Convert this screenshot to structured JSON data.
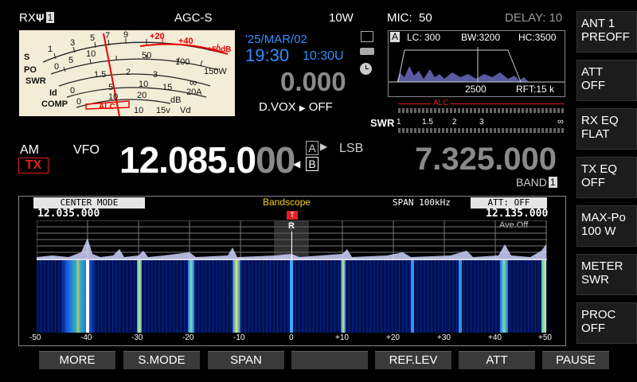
{
  "top": {
    "rx_label": "RX",
    "rx_num": "1",
    "agc": "AGC-S",
    "power": "10W",
    "mic_label": "MIC:",
    "mic_value": "50",
    "delay": "DELAY: 10"
  },
  "meter": {
    "scales": [
      "S",
      "PO",
      "SWR",
      "Id",
      "COMP"
    ],
    "s_ticks": [
      "1",
      "3",
      "5",
      "7",
      "9"
    ],
    "s_plus": [
      "+20",
      "+40",
      "+60dB"
    ],
    "po_ticks": [
      "0",
      "5",
      "10",
      "25",
      "50",
      "100",
      "150W"
    ],
    "swr_ticks": [
      "1",
      "1.5",
      "2",
      "3",
      "∞"
    ],
    "id_ticks": [
      "0",
      "5",
      "10",
      "15",
      "20A"
    ],
    "comp_ticks": [
      "0",
      "10",
      "20",
      "dB"
    ],
    "vd_ticks": [
      "10",
      "15v",
      "Vd"
    ],
    "alc": "ALC"
  },
  "clock": {
    "date": "'25/MAR/02",
    "time": "19:30",
    "utc": "10:30U",
    "offset": "0.000",
    "dvox": "D.VOX",
    "dvox_state": "OFF"
  },
  "filter": {
    "tag": "A",
    "lc": "LC: 300",
    "bw": "BW:3200",
    "hc": "HC:3500",
    "center": "2500",
    "rft": "RFT:15 k"
  },
  "sub_meter": {
    "alc": "ALC",
    "swr": "SWR",
    "swr_ticks": [
      "1",
      "1.5",
      "2",
      "3",
      "∞"
    ]
  },
  "main": {
    "mode": "AM",
    "tx": "TX",
    "vfo": "VFO",
    "freq_bright": "12.085.0",
    "freq_dim": "00",
    "vfo_a": "A",
    "vfo_b": "B",
    "sideband": "LSB",
    "sub_freq": "7.325.000",
    "band_label": "BAND",
    "band_num": "1"
  },
  "scope": {
    "mode": "CENTER MODE",
    "title": "Bandscope",
    "span": "SPAN 100kHz",
    "att": "ATT: OFF",
    "freq_left": "12.035.000",
    "freq_right": "12.135.000",
    "average": "Ave.Off",
    "marker_t": "T",
    "marker_r": "R",
    "ticks": [
      "-50",
      "-40",
      "-30",
      "-20",
      "-10",
      "0",
      "+10",
      "+20",
      "+30",
      "+40",
      "+50"
    ]
  },
  "side_buttons": [
    {
      "label": "ANT 1\nPREOFF"
    },
    {
      "label": "ATT\nOFF"
    },
    {
      "label": "RX EQ\nFLAT"
    },
    {
      "label": "TX EQ\nOFF"
    },
    {
      "label": "MAX-Po\n100 W"
    },
    {
      "label": "METER\nSWR"
    },
    {
      "label": "PROC\nOFF"
    }
  ],
  "bottom_buttons": [
    {
      "label": "MORE"
    },
    {
      "label": "S.MODE"
    },
    {
      "label": "SPAN"
    },
    {
      "label": ""
    },
    {
      "label": "REF.LEV"
    },
    {
      "label": "ATT"
    },
    {
      "label": "PAUSE"
    }
  ],
  "colors": {
    "accent_blue": "#2f8fff",
    "tx_red": "#e02020",
    "dim_gray": "#8a8a8a",
    "bandscope_yellow": "#f2d21b"
  }
}
